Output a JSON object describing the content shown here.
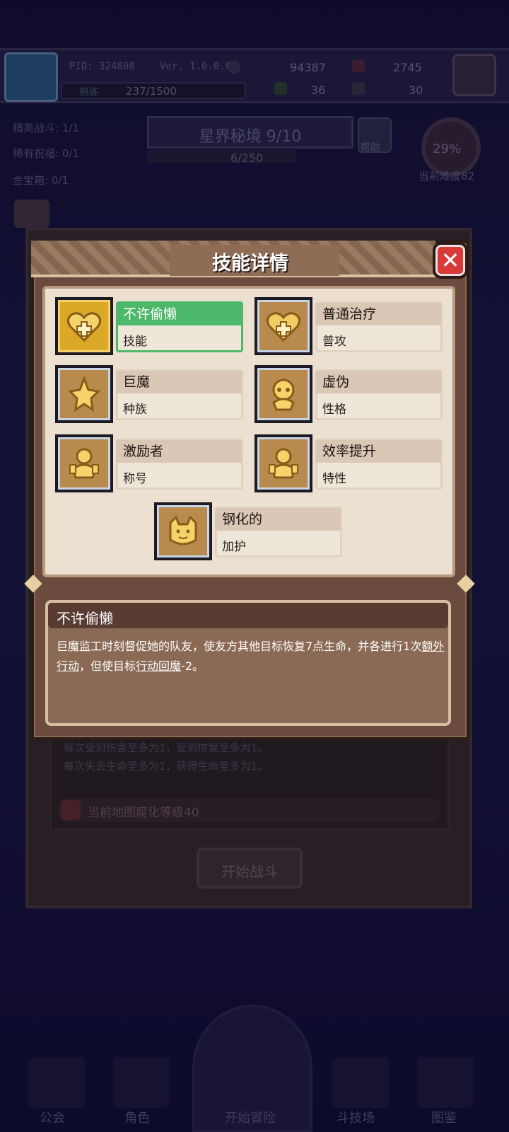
{
  "header": {
    "pid": "PID: 324808",
    "version": "Ver. 1.0.0.6",
    "resources": [
      "94387",
      "2745",
      "36",
      "30"
    ],
    "xp_label": "熟练",
    "xp": "237/1500"
  },
  "side_stats": [
    "精英战斗: 1/1",
    "稀有祝福: 0/1",
    "金宝箱: 0/1"
  ],
  "stage": {
    "title": "星界秘境 9/10",
    "progress": "6/250",
    "help_label": "帮助",
    "difficulty_pct": "29%",
    "difficulty_label": "当前难度82"
  },
  "background_panel": {
    "lines": [
      "每次受到伤害至多为1，受到恢复至多为1。",
      "每次失去生命至多为1，获得生命至多为1。"
    ],
    "warning": "当前地图腐化等级40",
    "start_button": "开始战斗"
  },
  "nav": {
    "items": [
      "公会",
      "角色",
      "开始冒险",
      "斗技场",
      "图鉴"
    ]
  },
  "dialog": {
    "title": "技能详情",
    "close_label": "✕",
    "tags": [
      {
        "name": "不许偷懒",
        "type": "技能",
        "icon": "heart-icon",
        "active": true
      },
      {
        "name": "普通治疗",
        "type": "普攻",
        "icon": "heart-icon",
        "active": false
      },
      {
        "name": "巨魔",
        "type": "种族",
        "icon": "star-icon",
        "active": false
      },
      {
        "name": "虚伪",
        "type": "性格",
        "icon": "mask-icon",
        "active": false
      },
      {
        "name": "激励者",
        "type": "称号",
        "icon": "figure-icon",
        "active": false
      },
      {
        "name": "效率提升",
        "type": "特性",
        "icon": "figure-icon",
        "active": false
      },
      {
        "name": "钢化的",
        "type": "加护",
        "icon": "cat-icon",
        "active": false
      }
    ],
    "detail": {
      "title": "不许偷懒",
      "text_1": "巨魔监工时刻督促她的队友，使友方其他目标恢复7点生命，并各进行1次",
      "text_link_1": "额外行动",
      "text_2": "，但使目标",
      "text_link_2": "行动回魔",
      "text_3": "-2。"
    }
  },
  "colors": {
    "active_tag": "#4db86a",
    "close_button": "#d83a3a",
    "dialog_frame": "#6a4b3e",
    "tag_area": "#ece0d0"
  }
}
